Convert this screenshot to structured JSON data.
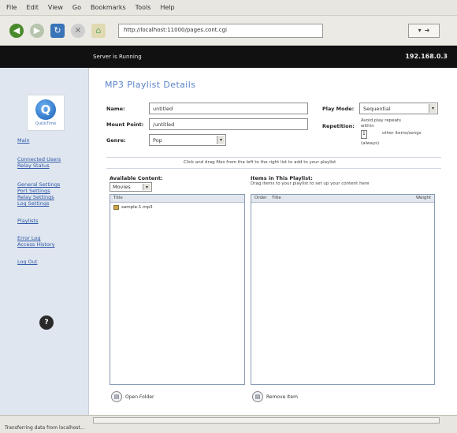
{
  "menu": [
    "File",
    "Edit",
    "View",
    "Go",
    "Bookmarks",
    "Tools",
    "Help"
  ],
  "url": "http://localhost:11000/pages.cont.cgi",
  "server_status": "Server is Running",
  "server_ip": "192.168.0.3",
  "sidebar": {
    "logo_text": "QuickTime",
    "links_group1": [
      "Main"
    ],
    "links_group2": [
      "Connected Users",
      "Relay Status"
    ],
    "links_group3": [
      "General Settings",
      "Port Settings",
      "Relay Settings",
      "Log Settings"
    ],
    "links_group4": [
      "Playlists"
    ],
    "links_group5": [
      "Error Log",
      "Access History"
    ],
    "links_group6": [
      "Log Out"
    ]
  },
  "form": {
    "title": "MP3 Playlist Details",
    "name_label": "Name:",
    "name_value": "untitled",
    "mount_label": "Mount Point:",
    "mount_value": "/untitled",
    "genre_label": "Genre:",
    "genre_value": "Pop",
    "playmode_label": "Play Mode:",
    "playmode_value": "Sequential",
    "repetition_label": "Repetition:",
    "repetition_text_1": "Avoid play repeats within",
    "repetition_value": "1",
    "repetition_text_2": "other items/songs",
    "repetition_text_3": "(always)",
    "hint": "Click and drag files from the left to the right list to add to your playlist"
  },
  "available": {
    "title": "Available Content:",
    "selector_value": "Movies",
    "column_header": "Title",
    "items": [
      "sample-1.mp3"
    ],
    "button_label": "Open Folder"
  },
  "playlist": {
    "title": "Items in This Playlist:",
    "subtitle": "Drag items to your playlist to set up your content here",
    "columns": [
      "Order",
      "Title",
      "Weight"
    ],
    "button_label": "Remove Item"
  },
  "statusbar": {
    "text": "Transferring data from localhost..."
  },
  "colors": {
    "title_blue": "#5a82c8",
    "link_blue": "#2f58a8",
    "sidebar_bg": "#dfe6ef"
  }
}
